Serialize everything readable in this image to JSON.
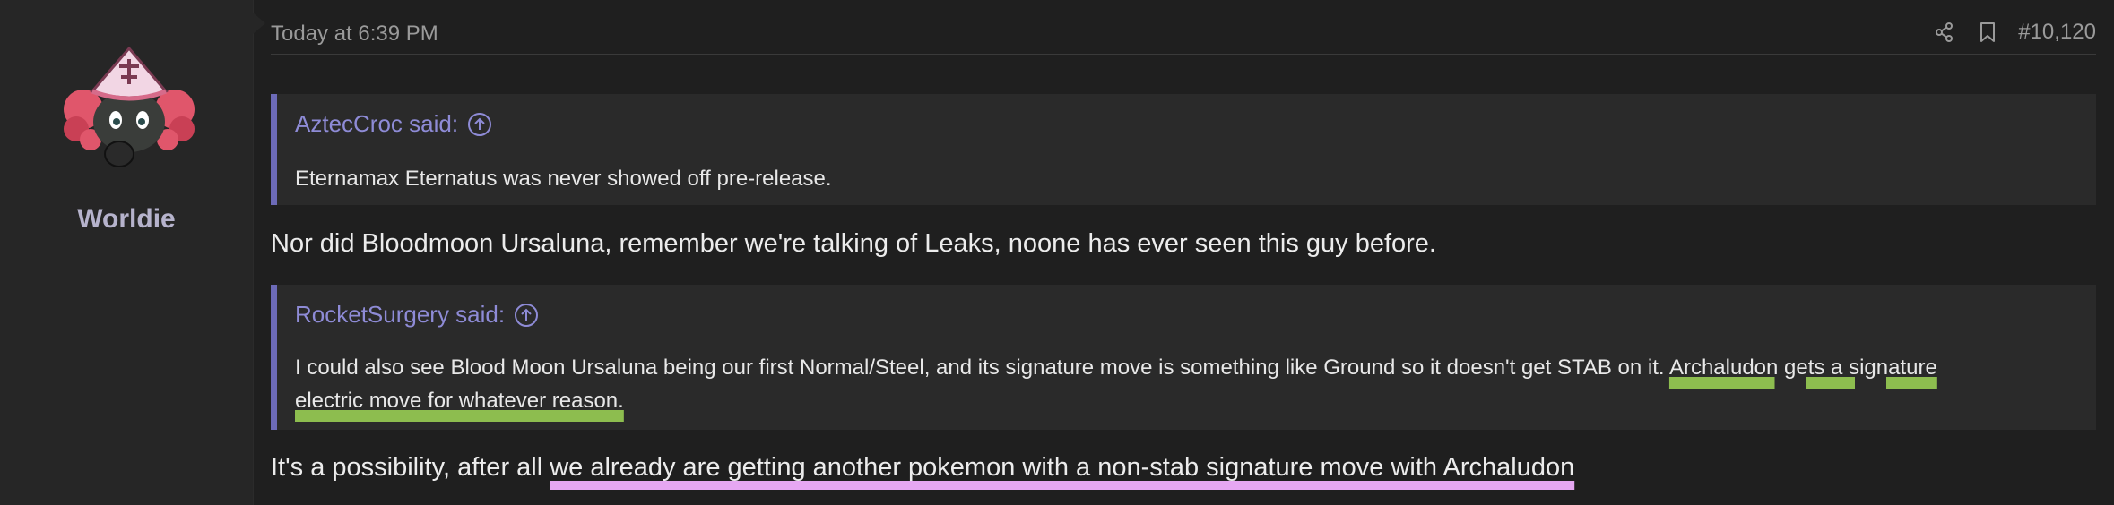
{
  "user": {
    "name": "Worldie",
    "avatar_icon": "pokemon-avatar-icon"
  },
  "post": {
    "timestamp": "Today at 6:39 PM",
    "post_number": "#10,120",
    "share_icon": "share-icon",
    "bookmark_icon": "bookmark-icon"
  },
  "quotes": [
    {
      "author": "AztecCroc said:",
      "body": "Eternamax Eternatus was never showed off pre-release."
    },
    {
      "author": "RocketSurgery said:",
      "body_plain": "I could also see Blood Moon Ursaluna being our first Normal/Steel, and its signature move is something like Ground so it doesn't get STAB on it. ",
      "body_highlight": "Archaludon gets a signature electric move for whatever reason."
    }
  ],
  "replies": [
    {
      "text": "Nor did Bloodmoon Ursaluna, remember we're talking of Leaks, noone has ever seen this guy before."
    },
    {
      "text_plain": "It's a possibility, after all ",
      "text_highlight": "we already are getting another pokemon with a non-stab signature move with Archaludon"
    }
  ],
  "colors": {
    "accent": "#6d6bb8",
    "quote_author": "#8e8bd6",
    "highlight_green": "#8dbd4f",
    "highlight_pink": "#e6a7f2",
    "background": "#1f1f1f"
  }
}
